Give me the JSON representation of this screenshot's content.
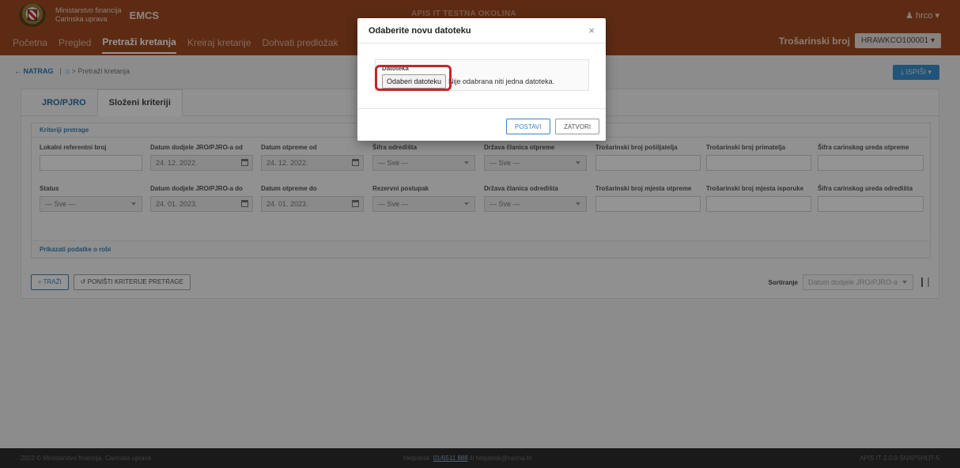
{
  "header": {
    "org_line1": "Ministarstvo financija",
    "org_line2": "Carinska uprava",
    "app_name": "EMCS",
    "environment": "APIS IT TESTNA OKOLINA",
    "user": "hrco"
  },
  "nav": {
    "items": [
      "Početna",
      "Pregled",
      "Pretraži kretanja",
      "Kreiraj kretanje",
      "Dohvati predložak"
    ],
    "active": "Pretraži kretanja",
    "excise_label": "Trošarinski broj",
    "excise_value": "HRAWKCO100001"
  },
  "breadcrumb": {
    "back": "← NATRAG",
    "current": "Pretraži kretanja",
    "print_button": "ISPIŠI"
  },
  "tabs": [
    "JRO/PJRO",
    "Složeni kriteriji"
  ],
  "criteria": {
    "title": "Kriteriji pretrage",
    "row1": [
      {
        "label": "Lokalni referentni broj",
        "value": ""
      },
      {
        "label": "Datum dodjele JRO/PJRO-a od",
        "value": "24. 12. 2022."
      },
      {
        "label": "Datum otpreme od",
        "value": "24. 12. 2022."
      },
      {
        "label": "Šifra odredišta",
        "value": "— Sve —"
      },
      {
        "label": "Država članica otpreme",
        "value": "— Sve —"
      },
      {
        "label": "Trošarinski broj pošiljatelja",
        "value": ""
      },
      {
        "label": "Trošarinski broj primatelja",
        "value": ""
      },
      {
        "label": "Šifra carinskog ureda otpreme",
        "value": ""
      }
    ],
    "row2": [
      {
        "label": "Status",
        "value": "— Sve —"
      },
      {
        "label": "Datum dodjele JRO/PJRO-a do",
        "value": "24. 01. 2023."
      },
      {
        "label": "Datum otpreme do",
        "value": "24. 01. 2023."
      },
      {
        "label": "Rezervni postupak",
        "value": "— Sve —"
      },
      {
        "label": "Država članica odredišta",
        "value": "— Sve —"
      },
      {
        "label": "Trošarinski broj mjesta otpreme",
        "value": ""
      },
      {
        "label": "Trošarinski broj mjesta isporuke",
        "value": ""
      },
      {
        "label": "Šifra carinskog ureda odredišta",
        "value": ""
      }
    ],
    "show_goods": "Prikazati podatke o robi"
  },
  "actions": {
    "search": "TRAŽI",
    "reset": "PONIŠTI KRITERIJE PRETRAGE",
    "sort_label": "Sortiranje",
    "sort_value": "Datum dodjele JRO/PJRO-a"
  },
  "footer": {
    "left": "2022 © Ministarstvo financija, Carinska uprava",
    "helpdesk_prefix": "Helpdesk:",
    "helpdesk_phone": "01/6511 888",
    "helpdesk_suffix": "ili helpdesk@carina.hr",
    "right": "APIS IT  2.0.0-SNAPSHOT-5"
  },
  "modal": {
    "title": "Odaberite novu datoteku",
    "close": "×",
    "file_label": "Datoteka",
    "file_button": "Odaberi datoteku",
    "file_status": "Nije odabrana niti jedna datoteka.",
    "confirm": "POSTAVI",
    "cancel": "ZATVORI"
  }
}
